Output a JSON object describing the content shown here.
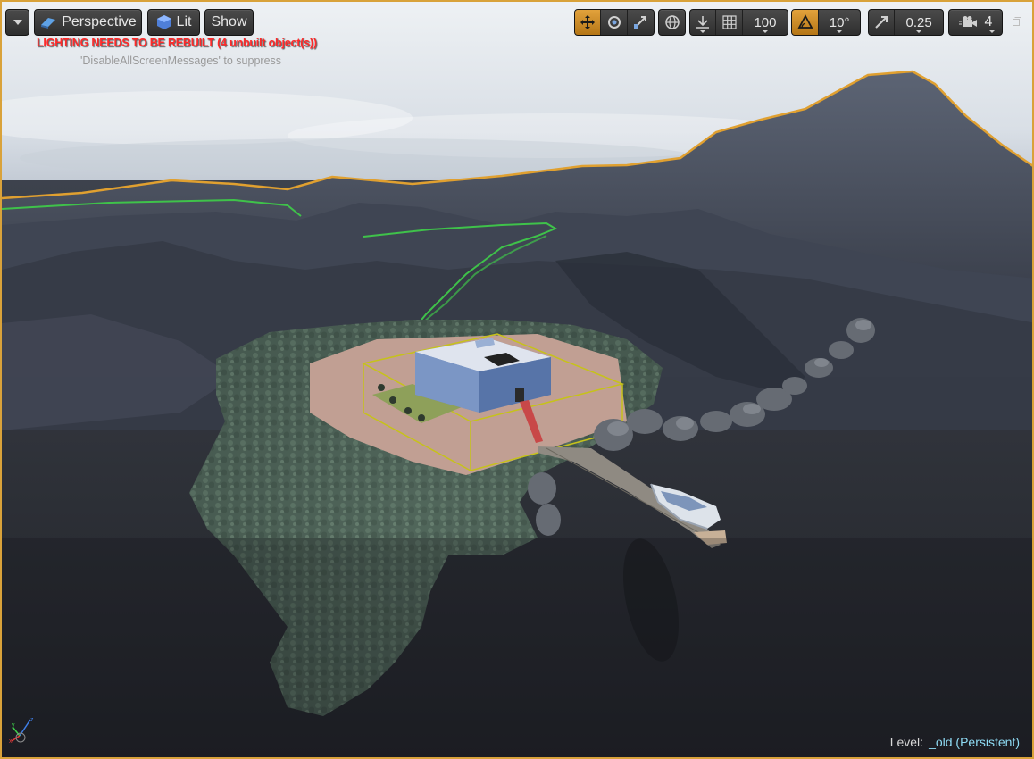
{
  "toolbar": {
    "view_mode": "Perspective",
    "lighting_mode": "Lit",
    "show_label": "Show",
    "grid_snap_value": "100",
    "rotation_snap_value": "10°",
    "scale_snap_value": "0.25",
    "camera_speed_value": "4"
  },
  "messages": {
    "lighting_warning": "LIGHTING NEEDS TO BE REBUILT (4 unbuilt object(s))",
    "suppress_hint": "'DisableAllScreenMessages' to suppress"
  },
  "level": {
    "label": "Level:",
    "name": "_old (Persistent)"
  },
  "colors": {
    "accent": "#e2a23c",
    "warning": "#ff2a2a",
    "level_name": "#8fdcf5",
    "selection_outline": "#e0a030"
  },
  "icons": [
    "viewport-menu-icon",
    "perspective-icon",
    "lit-icon",
    "translate-icon",
    "rotate-icon",
    "scale-icon",
    "world-local-icon",
    "surface-snap-icon",
    "grid-snap-icon",
    "rotation-snap-icon",
    "scale-snap-icon",
    "camera-speed-icon",
    "restore-viewport-icon",
    "axis-gizmo-icon"
  ]
}
